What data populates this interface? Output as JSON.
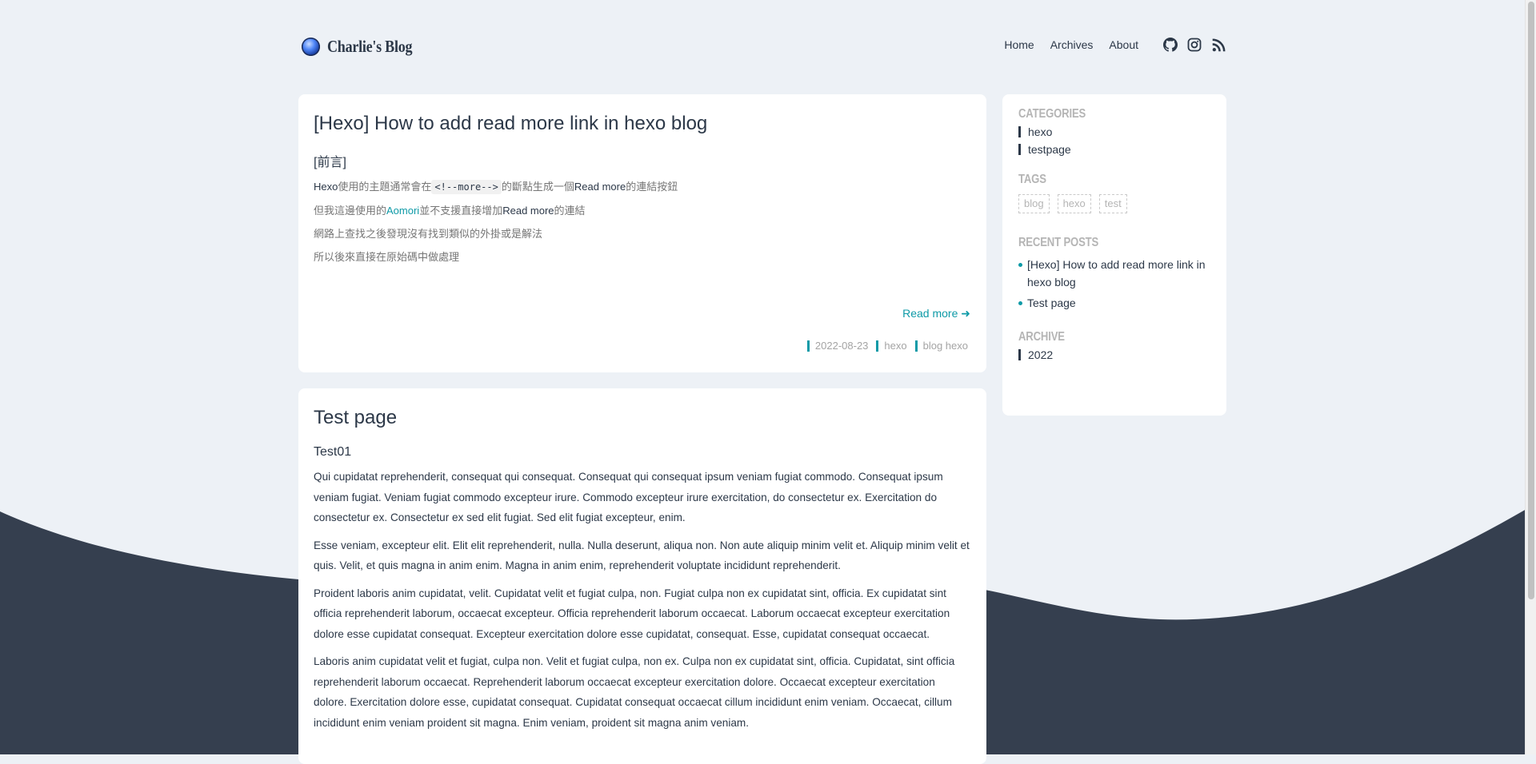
{
  "blog_title": "Charlie's Blog",
  "nav": {
    "home": "Home",
    "archives": "Archives",
    "about": "About"
  },
  "social": [
    "github-icon",
    "instagram-icon",
    "rss-icon"
  ],
  "colors": {
    "accent": "#0e9aa7",
    "text": "#2c3848",
    "background": "#edf1f6",
    "footer_wave": "#353f4f"
  },
  "posts": [
    {
      "title": "[Hexo] How to add read more link in hexo blog",
      "subheading": "[前言]",
      "p1_en": "Hexo",
      "p1_a": "使用的主題通常會在",
      "p1_code": "<!--more-->",
      "p1_b": "的斷點生成一個",
      "p1_rm": "Read more",
      "p1_c": "的連結按鈕",
      "p2_a": "但我這邊使用的",
      "p2_link": "Aomori",
      "p2_b": "並不支援直接增加",
      "p2_rm": "Read more",
      "p2_c": "的連結",
      "p3": "網路上查找之後發現沒有找到類似的外掛或是解法",
      "p4": "所以後來直接在原始碼中做處理",
      "read_more": "Read more ➜",
      "date": "2022-08-23",
      "category": "hexo",
      "tags": "blog hexo"
    },
    {
      "title": "Test page",
      "subheading": "Test01",
      "paragraphs": [
        "Qui cupidatat reprehenderit, consequat qui consequat. Consequat qui consequat ipsum veniam fugiat commodo. Consequat ipsum veniam fugiat. Veniam fugiat commodo excepteur irure. Commodo excepteur irure exercitation, do consectetur ex. Exercitation do consectetur ex. Consectetur ex sed elit fugiat. Sed elit fugiat excepteur, enim.",
        "Esse veniam, excepteur elit. Elit elit reprehenderit, nulla. Nulla deserunt, aliqua non. Non aute aliquip minim velit et. Aliquip minim velit et quis. Velit, et quis magna in anim enim. Magna in anim enim, reprehenderit voluptate incididunt reprehenderit.",
        "Proident laboris anim cupidatat, velit. Cupidatat velit et fugiat culpa, non. Fugiat culpa non ex cupidatat sint, officia. Ex cupidatat sint officia reprehenderit laborum, occaecat excepteur. Officia reprehenderit laborum occaecat. Laborum occaecat excepteur exercitation dolore esse cupidatat consequat. Excepteur exercitation dolore esse cupidatat, consequat. Esse, cupidatat consequat occaecat.",
        "Laboris anim cupidatat velit et fugiat, culpa non. Velit et fugiat culpa, non ex. Culpa non ex cupidatat sint, officia. Cupidatat, sint officia reprehenderit laborum occaecat. Reprehenderit laborum occaecat excepteur exercitation dolore. Occaecat excepteur exercitation dolore. Exercitation dolore esse, cupidatat consequat. Cupidatat consequat occaecat cillum incididunt enim veniam. Occaecat, cillum incididunt enim veniam proident sit magna. Enim veniam, proident sit magna anim veniam."
      ]
    }
  ],
  "sidebar": {
    "categories_title": "CATEGORIES",
    "categories": [
      "hexo",
      "testpage"
    ],
    "tags_title": "TAGS",
    "tags": [
      "blog",
      "hexo",
      "test"
    ],
    "recent_title": "RECENT POSTS",
    "recent": [
      "[Hexo] How to add read more link in hexo blog",
      "Test page"
    ],
    "archive_title": "ARCHIVE",
    "archive": [
      "2022"
    ]
  }
}
